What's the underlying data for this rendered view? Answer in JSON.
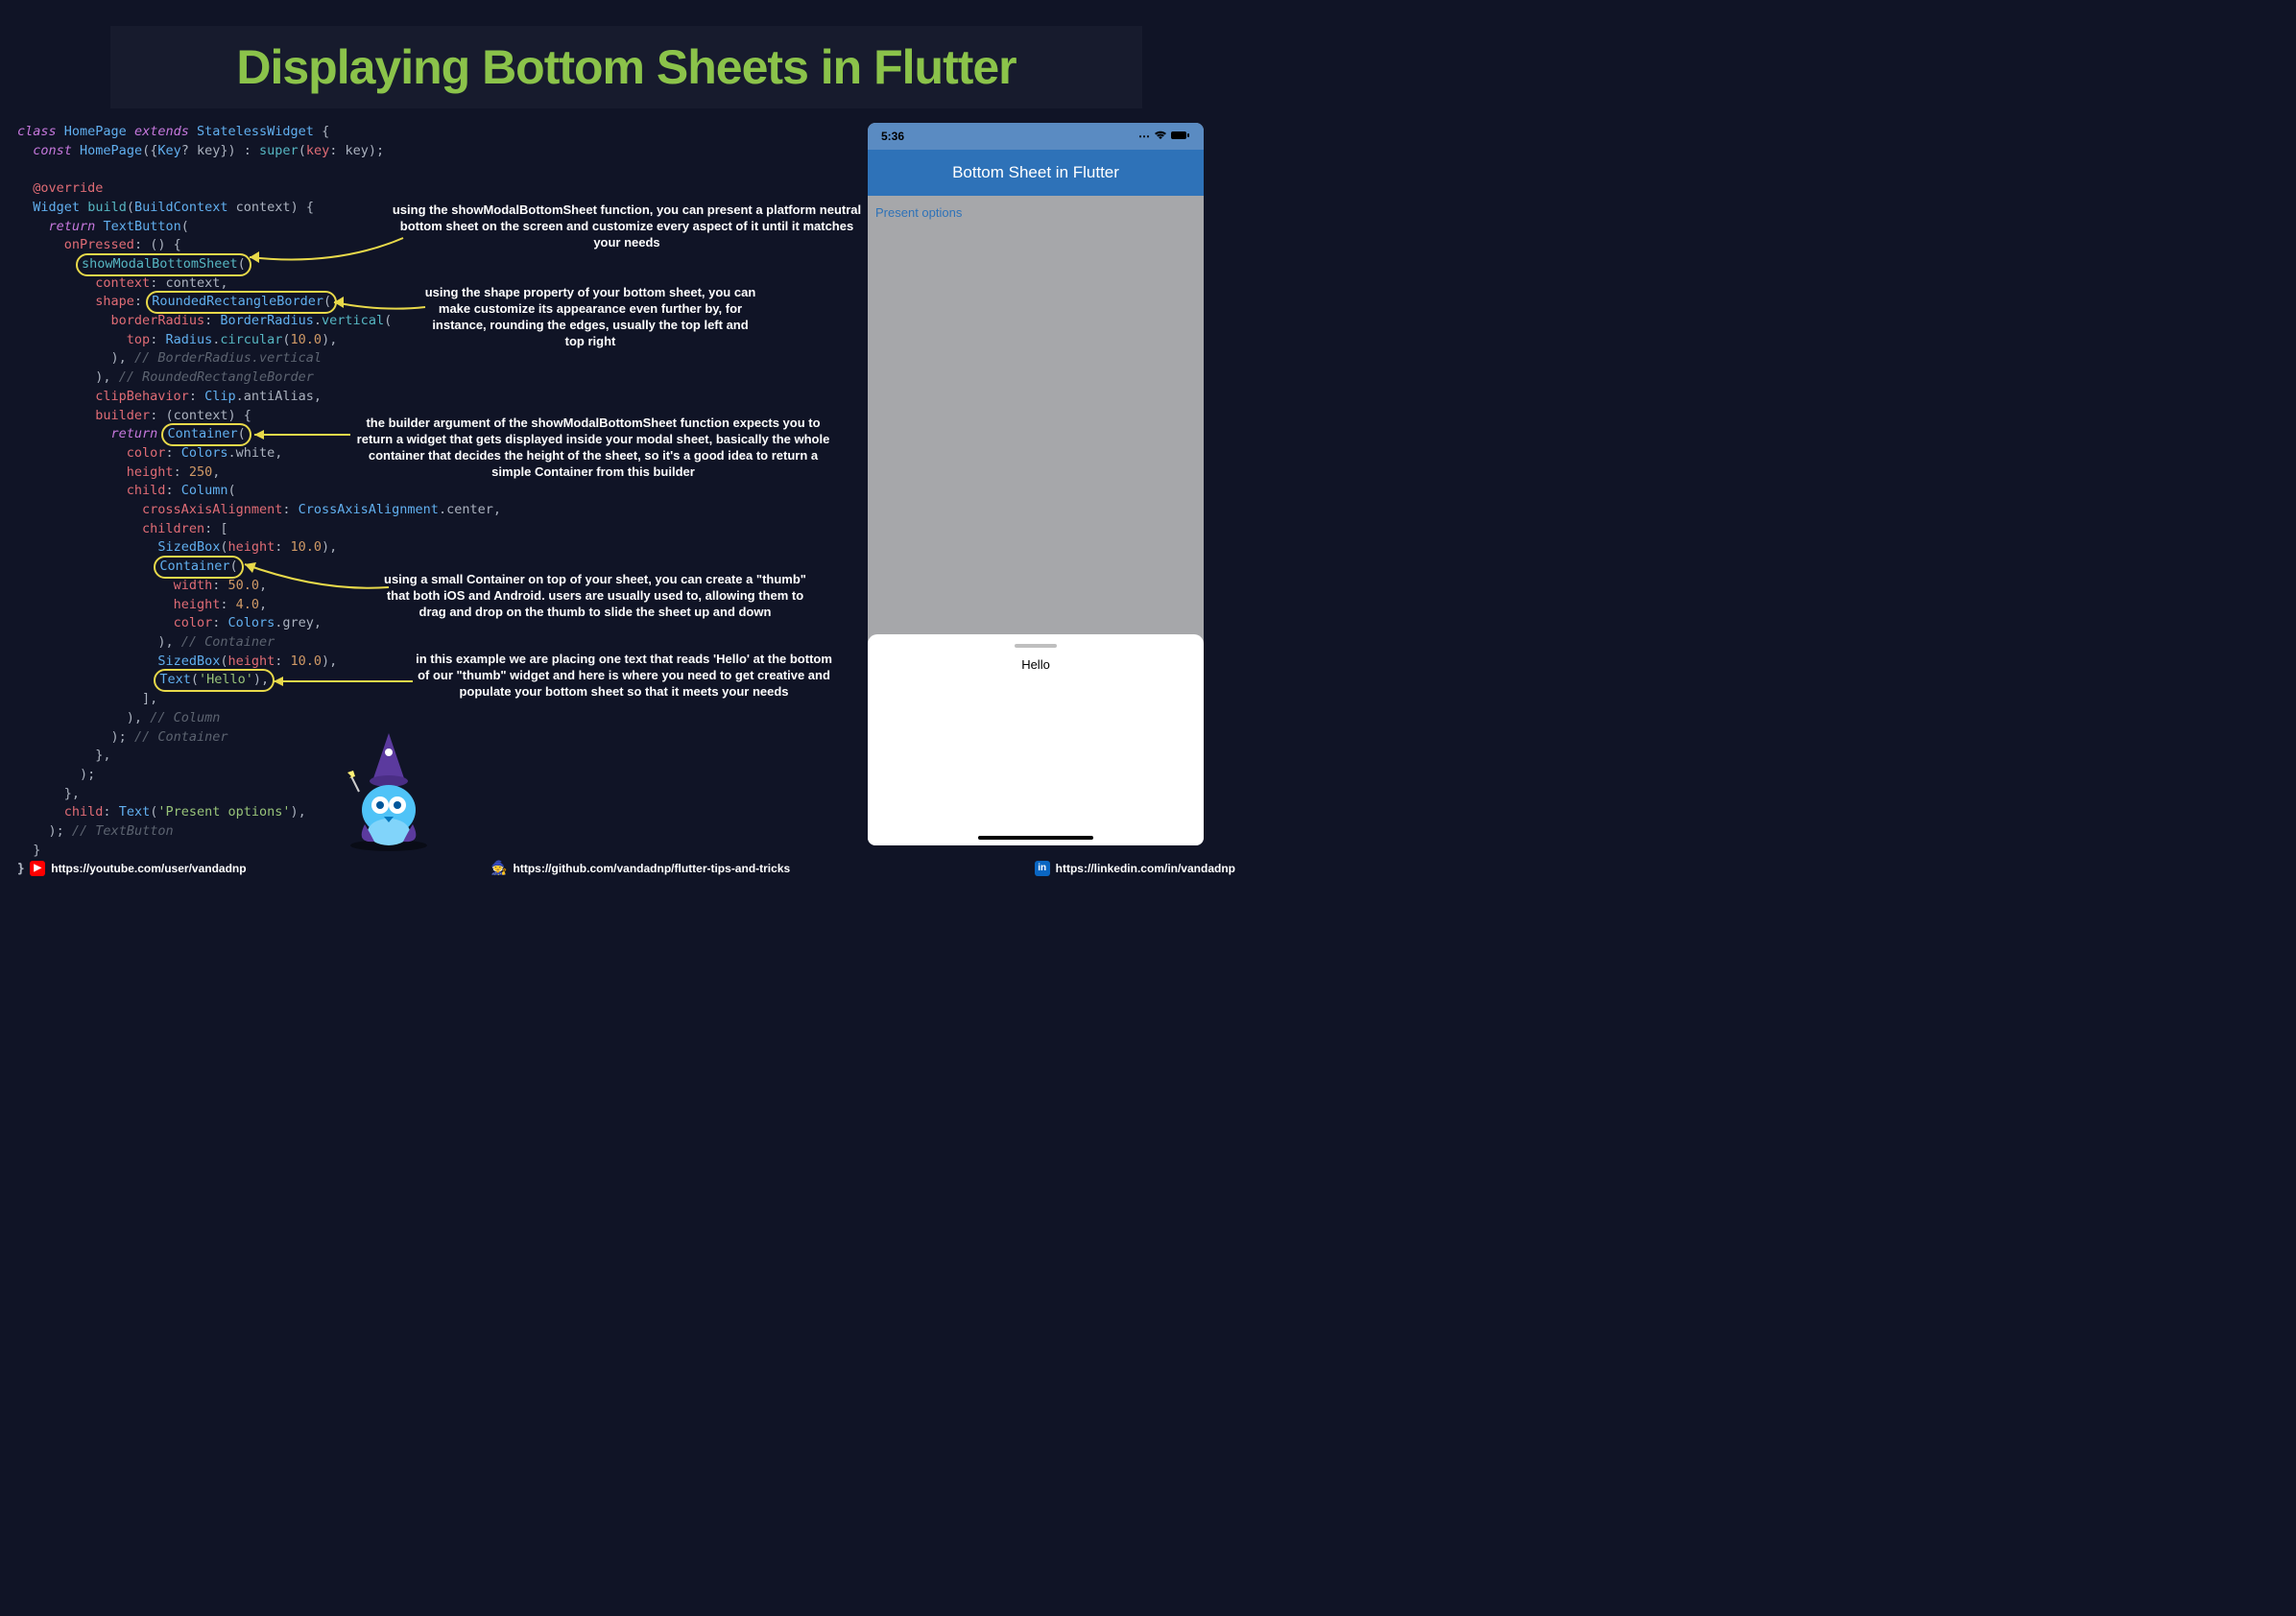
{
  "title": "Displaying Bottom Sheets in Flutter",
  "code": {
    "class_kw": "class",
    "HomePage": "HomePage",
    "extends_kw": "extends",
    "StatelessWidget": "StatelessWidget",
    "const_kw": "const",
    "Key": "Key",
    "key": "key",
    "super": "super",
    "override": "@override",
    "Widget": "Widget",
    "build": "build",
    "BuildContext": "BuildContext",
    "context": "context",
    "return_kw": "return",
    "TextButton": "TextButton",
    "onPressed": "onPressed",
    "showModalBottomSheet": "showModalBottomSheet",
    "context_named": "context",
    "shape_named": "shape",
    "RoundedRectangleBorder": "RoundedRectangleBorder",
    "borderRadius": "borderRadius",
    "BorderRadius": "BorderRadius",
    "vertical": "vertical",
    "top_named": "top",
    "Radius": "Radius",
    "circular": "circular",
    "ten": "10.0",
    "c_brv": "// BorderRadius.vertical",
    "c_rrb": "// RoundedRectangleBorder",
    "clipBehavior": "clipBehavior",
    "Clip": "Clip",
    "antiAlias": "antiAlias",
    "builder_named": "builder",
    "Container": "Container",
    "color_named": "color",
    "Colors": "Colors",
    "white": "white",
    "height_named": "height",
    "h250": "250",
    "child_named": "child",
    "Column": "Column",
    "crossAxisAlignment_named": "crossAxisAlignment",
    "CrossAxisAlignment": "CrossAxisAlignment",
    "center": "center",
    "children_named": "children",
    "SizedBox": "SizedBox",
    "width_named": "width",
    "w50": "50.0",
    "h4": "4.0",
    "grey": "grey",
    "c_container": "// Container",
    "Text": "Text",
    "hello": "'Hello'",
    "c_column": "// Column",
    "c_container2": "// Container",
    "present_options": "'Present options'",
    "c_textbutton": "// TextButton"
  },
  "annotations": {
    "a1": "using the showModalBottomSheet function, you can present a platform neutral bottom sheet on the screen and customize every aspect of it until it matches your needs",
    "a2": "using the shape property of your bottom sheet, you can make customize its appearance even further by, for instance, rounding the edges, usually the top left and top right",
    "a3": "the builder argument of the showModalBottomSheet function expects you to return a widget that gets displayed inside your modal sheet, basically the whole container that decides the height of the sheet, so it's a good idea to return a simple Container from this builder",
    "a4": "using a small Container on top of your sheet, you can create a \"thumb\" that both iOS and Android. users are usually used to, allowing them to drag and drop on the thumb to slide the sheet up and down",
    "a5": "in this example we are placing one text that reads 'Hello' at the bottom of our \"thumb\" widget and here is where you need to get creative and populate your bottom sheet so that it meets your needs"
  },
  "phone": {
    "time": "5:36",
    "appbar_title": "Bottom Sheet in Flutter",
    "button_label": "Present options",
    "sheet_text": "Hello"
  },
  "footer": {
    "youtube": "https://youtube.com/user/vandadnp",
    "github": "https://github.com/vandadnp/flutter-tips-and-tricks",
    "linkedin": "https://linkedin.com/in/vandadnp"
  }
}
